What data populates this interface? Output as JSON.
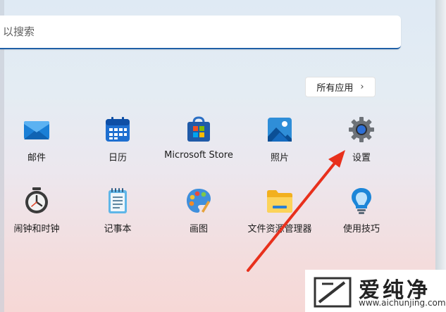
{
  "search": {
    "placeholder": "以搜索"
  },
  "all_apps": {
    "label": "所有应用",
    "chevron": "›"
  },
  "apps_row1": [
    {
      "label": "邮件",
      "icon": "mail-icon"
    },
    {
      "label": "日历",
      "icon": "calendar-icon"
    },
    {
      "label": "Microsoft Store",
      "icon": "store-icon"
    },
    {
      "label": "照片",
      "icon": "photos-icon"
    },
    {
      "label": "设置",
      "icon": "settings-gear-icon"
    }
  ],
  "apps_row2": [
    {
      "label": "闹钟和时钟",
      "icon": "alarm-clock-icon"
    },
    {
      "label": "记事本",
      "icon": "notepad-icon"
    },
    {
      "label": "画图",
      "icon": "paint-palette-icon"
    },
    {
      "label": "文件资源管理器",
      "icon": "folder-icon"
    },
    {
      "label": "使用技巧",
      "icon": "tips-bulb-icon"
    }
  ],
  "watermark": {
    "name": "爱纯净",
    "url": "www.aichunjing.com"
  },
  "colors": {
    "accent": "#1f5fa6",
    "arrow": "#e8301c"
  }
}
